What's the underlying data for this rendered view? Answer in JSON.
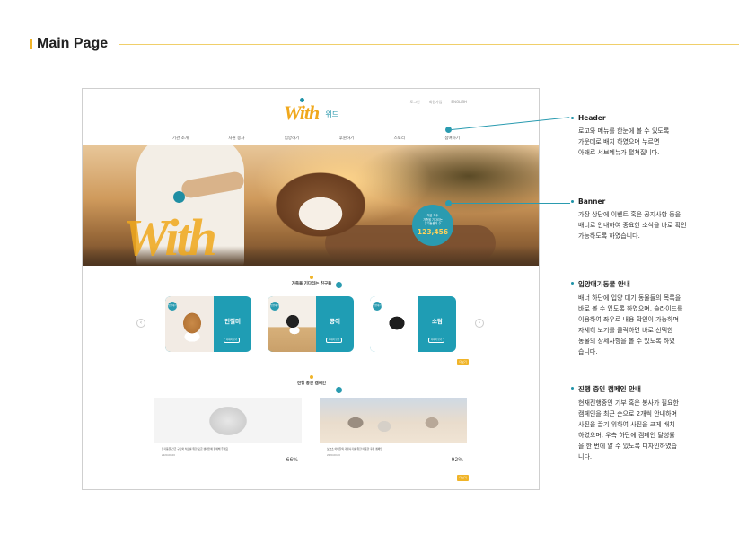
{
  "page": {
    "title": "Main Page"
  },
  "header": {
    "logo_text": "With",
    "logo_sub": "위드",
    "util_links": [
      "로그인",
      "회원가입",
      "ENGLISH"
    ],
    "nav": [
      "기관 소개",
      "자원 봉사",
      "입양하기",
      "후원하기",
      "스토리",
      "참여하기"
    ]
  },
  "banner": {
    "big_text": "With",
    "counter_line1": "지금 이수",
    "counter_line2": "가족을 기다리는",
    "counter_line3": "유기동물의 수",
    "counter_value": "123,456"
  },
  "adoption": {
    "title": "가족을 기다리는 친구들",
    "cards": [
      {
        "badge": "입양대기",
        "name": "인절미",
        "more": "자세히 보기"
      },
      {
        "badge": "입양대기",
        "name": "콩이",
        "more": "자세히 보기"
      },
      {
        "badge": "입양대기",
        "name": "소담",
        "more": "자세히 보기"
      }
    ],
    "more_label": "더보기"
  },
  "campaign": {
    "title": "진행 중인 캠페인",
    "items": [
      {
        "text": "유기동물 긴급 구조와 치료를 위한 모금 캠페인에 함께해 주세요",
        "date": "2020.00.00",
        "percent": "66%",
        "progress": 0.66
      },
      {
        "text": "보호소 아이들의 겨울나기를 위한 따뜻한 후원 캠페인",
        "date": "2020.00.00",
        "percent": "92%",
        "progress": 0.92
      }
    ],
    "more_label": "더보기"
  },
  "callouts": [
    {
      "title": "Header",
      "desc": "로고와 메뉴를 한눈에 볼 수 있도록\n가운데로 배치 하였으며 누르면\n아래로 서브메뉴가 펼쳐집니다."
    },
    {
      "title": "Banner",
      "desc": "가장 상단에 이벤트 혹은 공지사항 등을\n배너로 안내하여 중요한 소식을 바로 확인\n가능하도록 하였습니다."
    },
    {
      "title": "입양대기동물 안내",
      "desc": "배너 하단에 입양 대기 동물들의 목록을\n바로 볼 수 있도록 하였으며, 슬라이드를\n이용하여 좌우로 내용 확인이 가능하며\n자세히 보기를 클릭하면 바로 선택한\n동물의 상세사항을 볼 수 있도록 하였\n습니다."
    },
    {
      "title": "진행 중인 캠페인 안내",
      "desc": "현재진행중인 기부 혹은 봉사가 필요한\n캠페인을 최근 순으로 2개씩 안내하며\n사진을 끌기 위하여 사진을 크게 배치\n하였으며, 우측 하단에 캠페인 달성률\n을 한 번에 알 수 있도록 디자인하였습\n니다."
    }
  ],
  "colors": {
    "accent": "#f0b429",
    "teal": "#1f9db4"
  }
}
